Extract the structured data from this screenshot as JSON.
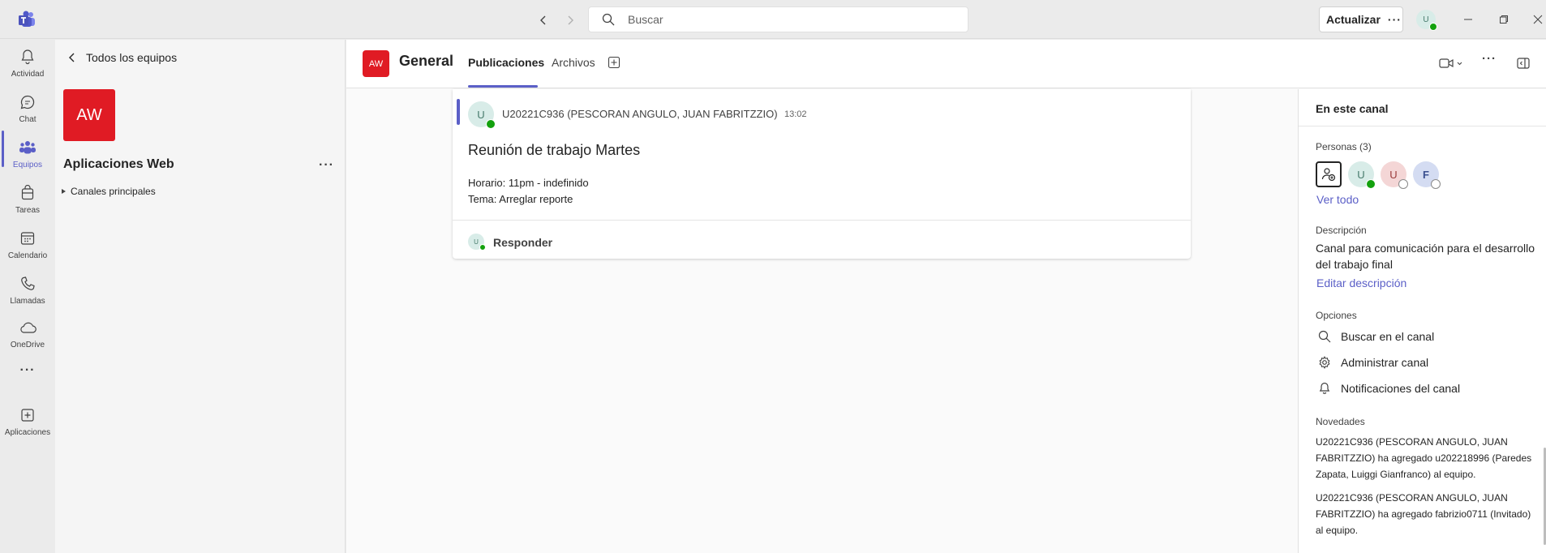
{
  "titlebar": {
    "search_placeholder": "Buscar",
    "update_label": "Actualizar",
    "update_more": "···",
    "user_initial": "U"
  },
  "rail": {
    "items": [
      {
        "label": "Actividad",
        "icon": "bell-icon"
      },
      {
        "label": "Chat",
        "icon": "chat-icon"
      },
      {
        "label": "Equipos",
        "icon": "teams-icon"
      },
      {
        "label": "Tareas",
        "icon": "tasks-icon"
      },
      {
        "label": "Calendario",
        "icon": "calendar-icon"
      },
      {
        "label": "Llamadas",
        "icon": "phone-icon"
      },
      {
        "label": "OneDrive",
        "icon": "cloud-icon"
      },
      {
        "label": "Aplicaciones",
        "icon": "add-app-icon"
      }
    ],
    "more": "···",
    "accent": "#5b5fc7"
  },
  "teams_panel": {
    "back_label": "Todos los equipos",
    "team_initials": "AW",
    "team_name": "Aplicaciones Web",
    "team_more": "···",
    "channels_group": "Canales principales"
  },
  "channel": {
    "initials": "AW",
    "title": "General",
    "tabs": [
      {
        "label": "Publicaciones",
        "active": true
      },
      {
        "label": "Archivos",
        "active": false
      }
    ]
  },
  "post": {
    "author_initial": "U",
    "author": "U20221C936 (PESCORAN ANGULO, JUAN FABRITZZIO)",
    "time": "13:02",
    "title": "Reunión de trabajo Martes",
    "line1": "Horario: 11pm - indefinido",
    "line2": "Tema: Arreglar reporte",
    "reply_initial": "U",
    "reply_label": "Responder"
  },
  "info_panel": {
    "title": "En este canal",
    "people_label": "Personas (3)",
    "people": [
      {
        "initial": "U",
        "bg": "#d8ece8",
        "fg": "#467a6b",
        "status": "available"
      },
      {
        "initial": "U",
        "bg": "#f4d6d6",
        "fg": "#9a3a3a",
        "status": "offline"
      },
      {
        "initial": "F",
        "bg": "#d4dcf2",
        "fg": "#3a4f8f",
        "status": "offline"
      }
    ],
    "see_all": "Ver todo",
    "description_label": "Descripción",
    "description": "Canal para comunicación para el desarrollo del trabajo final",
    "edit_description": "Editar descripción",
    "options_label": "Opciones",
    "options": [
      {
        "label": "Buscar en el canal",
        "icon": "search-icon"
      },
      {
        "label": "Administrar canal",
        "icon": "gear-icon"
      },
      {
        "label": "Notificaciones del canal",
        "icon": "bell-icon"
      }
    ],
    "news_label": "Novedades",
    "news": [
      "U20221C936 (PESCORAN ANGULO, JUAN FABRITZZIO) ha agregado u202218996 (Paredes Zapata, Luiggi Gianfranco) al equipo.",
      "U20221C936 (PESCORAN ANGULO, JUAN FABRITZZIO) ha agregado fabrizio0711 (Invitado) al equipo."
    ]
  },
  "colors": {
    "brand": "#5b5fc7",
    "team_red": "#e01b24",
    "available": "#13a10e"
  }
}
